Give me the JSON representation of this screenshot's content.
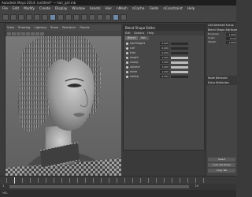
{
  "app": {
    "title": "Autodesk Maya 2014: /untitled*  ---  hair_girl.mb"
  },
  "menu": [
    "File",
    "Edit",
    "Modify",
    "Create",
    "Display",
    "Window",
    "Assets",
    "Hair",
    "nMesh",
    "nCache",
    "Fields",
    "nConstraint",
    "Help"
  ],
  "viewport": {
    "menu": [
      "View",
      "Shading",
      "Lighting",
      "Show",
      "Renderer",
      "Panels"
    ]
  },
  "panel": {
    "title": "Blend Shape Editor",
    "menu": [
      "Edit",
      "Options",
      "Help"
    ],
    "tabs": [
      "Blend",
      "Hair"
    ],
    "rows": [
      {
        "name": "hairShape1",
        "value": "0.000",
        "level": 0.0
      },
      {
        "name": "curl",
        "value": "0.000",
        "level": 0.0
      },
      {
        "name": "frizz",
        "value": "0.000",
        "level": 0.0
      },
      {
        "name": "length",
        "value": "1.000",
        "level": 1.0
      },
      {
        "name": "clump",
        "value": "1.000",
        "level": 1.0
      },
      {
        "name": "volume",
        "value": "1.000",
        "level": 1.0
      },
      {
        "name": "shine",
        "value": "1.000",
        "level": 1.0
      },
      {
        "name": "sweep",
        "value": "0.000",
        "level": 0.0
      }
    ]
  },
  "attr": {
    "tabs": [
      "List",
      "Selected",
      "Focus"
    ],
    "sections": [
      "Blend Shape Attributes",
      "Node Behavior",
      "Extra Attributes"
    ],
    "fields": [
      {
        "label": "Envelope",
        "value": "1.000"
      },
      {
        "label": "Origin",
        "value": "local"
      },
      {
        "label": "Weight",
        "value": "1.000"
      }
    ],
    "buttons": [
      "Select",
      "Load Attributes",
      "Copy Tab"
    ]
  },
  "timeline": {
    "current_fraction": 0.04
  },
  "range": {
    "start": "1",
    "end": "24"
  },
  "command": {
    "prompt": "MEL"
  }
}
